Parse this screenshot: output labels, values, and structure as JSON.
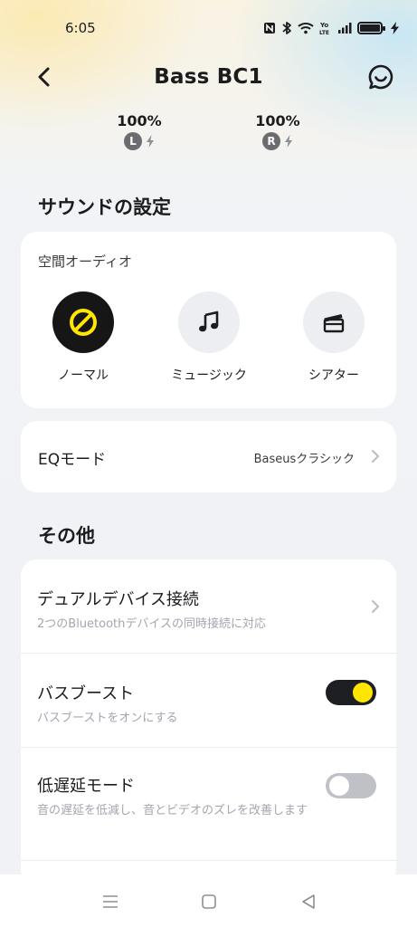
{
  "status_bar": {
    "time": "6:05",
    "icons": [
      "nfc-icon",
      "bluetooth-icon",
      "wifi-icon",
      "volte-icon",
      "signal-icon",
      "battery-icon",
      "charging-icon"
    ],
    "volte_text": "Yo LTE"
  },
  "header": {
    "title": "Bass BC1",
    "back_icon": "back-arrow-icon",
    "chat_icon": "chat-icon"
  },
  "earbuds": {
    "left": {
      "percent": "100%",
      "side": "L",
      "charging": true
    },
    "right": {
      "percent": "100%",
      "side": "R",
      "charging": true
    }
  },
  "sound_settings": {
    "title": "サウンドの設定",
    "spatial_audio": {
      "label": "空間オーディオ",
      "modes": [
        {
          "label": "ノーマル",
          "icon": "off-icon",
          "selected": true
        },
        {
          "label": "ミュージック",
          "icon": "music-note-icon",
          "selected": false
        },
        {
          "label": "シアター",
          "icon": "clapperboard-icon",
          "selected": false
        }
      ]
    },
    "eq": {
      "label": "EQモード",
      "value": "Baseusクラシック"
    }
  },
  "other": {
    "title": "その他",
    "items": [
      {
        "name": "デュアルデバイス接続",
        "desc": "2つのBluetoothデバイスの同時接続に対応",
        "control": "chevron"
      },
      {
        "name": "バスブースト",
        "desc": "バスブーストをオンにする",
        "control": "toggle",
        "on": true
      },
      {
        "name": "低遅延モード",
        "desc": "音の遅延を低減し、音とビデオのズレを改善します",
        "control": "toggle",
        "on": false
      }
    ]
  },
  "colors": {
    "accent": "#FFE600",
    "toggle_on": "#1E1F22",
    "toggle_off": "#BFC1C7",
    "text_secondary": "#A2A6AE"
  },
  "nav_bar": {
    "buttons": [
      "menu-icon",
      "home-icon",
      "back-triangle-icon"
    ]
  }
}
